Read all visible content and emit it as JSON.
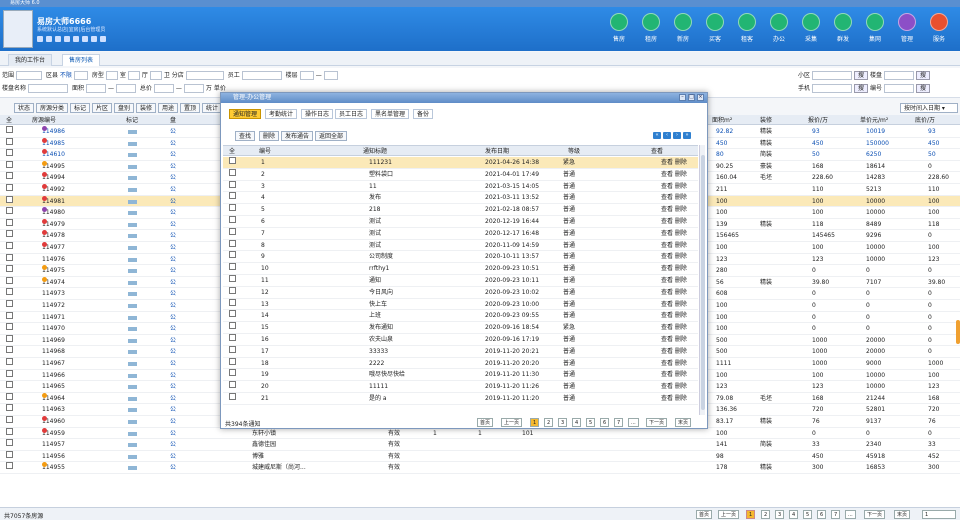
{
  "window_title": "易房大师 6.0",
  "header": {
    "user_name": "易房大师6666",
    "user_sub": "系统默认总店|宜房|后台管理员",
    "nav": [
      {
        "label": "售房",
        "icon": "home-icon",
        "color": "#22b573"
      },
      {
        "label": "租房",
        "icon": "home-key-icon",
        "color": "#22b573"
      },
      {
        "label": "新房",
        "icon": "building-icon",
        "color": "#22b573"
      },
      {
        "label": "买客",
        "icon": "buyer-icon",
        "color": "#22b573"
      },
      {
        "label": "租客",
        "icon": "tenant-icon",
        "color": "#22b573"
      },
      {
        "label": "办公",
        "icon": "office-icon",
        "color": "#22b573"
      },
      {
        "label": "采集",
        "icon": "cloud-icon",
        "color": "#22b573"
      },
      {
        "label": "群发",
        "icon": "send-icon",
        "color": "#22b573"
      },
      {
        "label": "集网",
        "icon": "network-icon",
        "color": "#22b573"
      },
      {
        "label": "管理",
        "icon": "gear-icon",
        "color": "#8c4fc7"
      },
      {
        "label": "服务",
        "icon": "service-icon",
        "color": "#e8502f"
      }
    ]
  },
  "tabs": [
    {
      "label": "我的工作台"
    },
    {
      "label": "售房列表"
    }
  ],
  "filter": {
    "row1": [
      "范围",
      "区县",
      "不限",
      "房型",
      "室",
      "厅",
      "卫",
      "分店",
      "员工",
      "楼层",
      "—"
    ],
    "row2": [
      "楼盘名称",
      "面积",
      "—",
      "总价",
      "—",
      "万",
      "单价"
    ],
    "right1": [
      "小区",
      "楼盘"
    ],
    "right2": [
      "手机",
      "编号"
    ],
    "search_btn": "搜"
  },
  "toolbar": [
    "状态",
    "房源分类",
    "标记",
    "片区",
    "盘别",
    "装修",
    "用途",
    "置顶",
    "统计"
  ],
  "sort_select": "按时间入日期",
  "grid": {
    "headers": [
      "全",
      "房源编号",
      "标记",
      "盘",
      "面积m²",
      "装修",
      "报价/万",
      "单价元/m²",
      "底价/万"
    ],
    "rows": [
      {
        "id": "114986",
        "flag": "#8e44ad",
        "bei": "公",
        "area": "92.82",
        "deco": "精装",
        "price": "93",
        "unit": "10019",
        "base": "93",
        "blue": true
      },
      {
        "id": "114985",
        "flag": "#e03b3b",
        "bei": "公",
        "area": "450",
        "deco": "精装",
        "price": "450",
        "unit": "150000",
        "base": "450",
        "blue": true
      },
      {
        "id": "114610",
        "flag": "#e03b3b",
        "bei": "公",
        "area": "80",
        "deco": "简装",
        "price": "50",
        "unit": "6250",
        "base": "50",
        "blue": true
      },
      {
        "id": "114995",
        "flag": "#f39c12",
        "bei": "公",
        "area": "90.25",
        "deco": "豪装",
        "price": "168",
        "unit": "18614",
        "base": "0"
      },
      {
        "id": "114994",
        "flag": "#e03b3b",
        "bei": "公",
        "area": "160.04",
        "deco": "毛坯",
        "price": "228.60",
        "unit": "14283",
        "base": "228.60"
      },
      {
        "id": "114992",
        "flag": "#e03b3b",
        "bei": "公",
        "area": "211",
        "deco": "",
        "price": "110",
        "unit": "5213",
        "base": "110"
      },
      {
        "id": "114981",
        "flag": "#e03b3b",
        "bei": "公",
        "area": "100",
        "deco": "",
        "price": "100",
        "unit": "10000",
        "base": "100",
        "sel": true
      },
      {
        "id": "114980",
        "flag": "#8e44ad",
        "bei": "公",
        "area": "100",
        "deco": "",
        "price": "100",
        "unit": "10000",
        "base": "100"
      },
      {
        "id": "114979",
        "flag": "#e03b3b",
        "bei": "公",
        "area": "139",
        "deco": "精装",
        "price": "118",
        "unit": "8489",
        "base": "118"
      },
      {
        "id": "114978",
        "flag": "#e03b3b",
        "bei": "公",
        "area": "156465",
        "deco": "",
        "price": "145465",
        "unit": "9296",
        "base": "0"
      },
      {
        "id": "114977",
        "flag": "#e03b3b",
        "bei": "公",
        "area": "100",
        "deco": "",
        "price": "100",
        "unit": "10000",
        "base": "100"
      },
      {
        "id": "114976",
        "flag": "",
        "bei": "公",
        "area": "123",
        "deco": "",
        "price": "123",
        "unit": "10000",
        "base": "123"
      },
      {
        "id": "114975",
        "flag": "#f39c12",
        "bei": "公",
        "area": "280",
        "deco": "",
        "price": "0",
        "unit": "0",
        "base": "0"
      },
      {
        "id": "114974",
        "flag": "#f39c12",
        "bei": "公",
        "area": "56",
        "deco": "精装",
        "price": "39.80",
        "unit": "7107",
        "base": "39.80"
      },
      {
        "id": "114973",
        "flag": "",
        "bei": "公",
        "area": "608",
        "deco": "",
        "price": "0",
        "unit": "0",
        "base": "0"
      },
      {
        "id": "114972",
        "flag": "",
        "bei": "公",
        "area": "100",
        "deco": "",
        "price": "0",
        "unit": "0",
        "base": "0"
      },
      {
        "id": "114971",
        "flag": "",
        "bei": "公",
        "area": "100",
        "deco": "",
        "price": "0",
        "unit": "0",
        "base": "0"
      },
      {
        "id": "114970",
        "flag": "",
        "bei": "公",
        "area": "100",
        "deco": "",
        "price": "0",
        "unit": "0",
        "base": "0"
      },
      {
        "id": "114969",
        "flag": "",
        "bei": "公",
        "area": "500",
        "deco": "",
        "price": "1000",
        "unit": "20000",
        "base": "0"
      },
      {
        "id": "114968",
        "flag": "",
        "bei": "公",
        "area": "500",
        "deco": "",
        "price": "1000",
        "unit": "20000",
        "base": "0"
      },
      {
        "id": "114967",
        "flag": "",
        "bei": "公",
        "area": "1111",
        "deco": "",
        "price": "1000",
        "unit": "9000",
        "base": "1000"
      },
      {
        "id": "114966",
        "flag": "",
        "bei": "公",
        "area": "100",
        "deco": "",
        "price": "100",
        "unit": "10000",
        "base": "100"
      },
      {
        "id": "114965",
        "flag": "",
        "bei": "公",
        "area": "123",
        "deco": "",
        "price": "123",
        "unit": "10000",
        "base": "123"
      },
      {
        "id": "114964",
        "flag": "#f39c12",
        "bei": "公",
        "area": "79.08",
        "deco": "毛坯",
        "price": "168",
        "unit": "21244",
        "base": "168"
      },
      {
        "id": "114963",
        "flag": "",
        "bei": "公",
        "area": "136.36",
        "deco": "",
        "price": "720",
        "unit": "52801",
        "base": "720"
      },
      {
        "id": "114960",
        "flag": "#e03b3b",
        "bei": "公",
        "area": "83.17",
        "deco": "精装",
        "price": "76",
        "unit": "9137",
        "base": "76"
      },
      {
        "id": "114959",
        "flag": "#e03b3b",
        "bei": "公",
        "area": "100",
        "deco": "",
        "price": "0",
        "unit": "0",
        "base": "0"
      },
      {
        "id": "114957",
        "flag": "",
        "bei": "公",
        "area": "141",
        "deco": "简装",
        "price": "33",
        "unit": "2340",
        "base": "33"
      },
      {
        "id": "114956",
        "flag": "",
        "bei": "公",
        "area": "98",
        "deco": "",
        "price": "450",
        "unit": "45918",
        "base": "452"
      },
      {
        "id": "114955",
        "flag": "#f39c12",
        "bei": "公",
        "area": "178",
        "deco": "精装",
        "price": "300",
        "unit": "16853",
        "base": "300"
      }
    ],
    "behind_modal": [
      {
        "name": "东轩小镇",
        "status": "有效",
        "a": "1",
        "b": "1",
        "c": "101"
      },
      {
        "name": "鑫德佳园",
        "status": "有效",
        "a": "",
        "b": "",
        "c": ""
      },
      {
        "name": "博雅",
        "status": "有效",
        "a": "",
        "b": "",
        "c": ""
      },
      {
        "name": "城建威尼斯（尚河...",
        "status": "有效",
        "a": "",
        "b": "",
        "c": ""
      }
    ]
  },
  "status": {
    "total": "共7057条房源",
    "pager": [
      "首页",
      "上一页",
      "1",
      "2",
      "3",
      "4",
      "5",
      "6",
      "7",
      "...",
      "下一页",
      "末页",
      "1"
    ]
  },
  "modal": {
    "title": "管理-办公管理",
    "tabs": [
      {
        "label": "通知管理"
      },
      {
        "label": "考勤统计"
      },
      {
        "label": "操作日志"
      },
      {
        "label": "员工日志"
      },
      {
        "label": "黑名单管理"
      },
      {
        "label": "备份"
      }
    ],
    "tools": [
      "查找",
      "删除",
      "发布通告",
      "返回全部"
    ],
    "headers": [
      "全",
      "编号",
      "通知标题",
      "发布日期",
      "等级",
      "查看"
    ],
    "rows": [
      {
        "no": "1",
        "title": "111231",
        "date": "2021-04-26 14:38",
        "level": "紧急",
        "sel": true
      },
      {
        "no": "2",
        "title": "塑料袋口",
        "date": "2021-04-01 17:49",
        "level": "普通"
      },
      {
        "no": "3",
        "title": "11",
        "date": "2021-03-15 14:05",
        "level": "普通"
      },
      {
        "no": "4",
        "title": "发布",
        "date": "2021-03-11 13:52",
        "level": "普通"
      },
      {
        "no": "5",
        "title": "218",
        "date": "2021-02-18 08:57",
        "level": "普通"
      },
      {
        "no": "6",
        "title": "测试",
        "date": "2020-12-19 16:44",
        "level": "普通"
      },
      {
        "no": "7",
        "title": "测试",
        "date": "2020-12-17 16:48",
        "level": "普通"
      },
      {
        "no": "8",
        "title": "测试",
        "date": "2020-11-09 14:59",
        "level": "普通"
      },
      {
        "no": "9",
        "title": "公司制度",
        "date": "2020-10-11 13:57",
        "level": "普通"
      },
      {
        "no": "10",
        "title": "rrfthy1",
        "date": "2020-09-23 10:51",
        "level": "普通"
      },
      {
        "no": "11",
        "title": "通知",
        "date": "2020-09-23 10:11",
        "level": "普通"
      },
      {
        "no": "12",
        "title": "今日风向",
        "date": "2020-09-23 10:02",
        "level": "普通"
      },
      {
        "no": "13",
        "title": "快上车",
        "date": "2020-09-23 10:00",
        "level": "普通"
      },
      {
        "no": "14",
        "title": "上班",
        "date": "2020-09-23 09:55",
        "level": "普通"
      },
      {
        "no": "15",
        "title": "发布通知",
        "date": "2020-09-16 18:54",
        "level": "紧急"
      },
      {
        "no": "16",
        "title": "农夫山泉",
        "date": "2020-09-16 17:19",
        "level": "普通"
      },
      {
        "no": "17",
        "title": "33333",
        "date": "2019-11-20 20:21",
        "level": "普通"
      },
      {
        "no": "18",
        "title": "2222",
        "date": "2019-11-20 20:20",
        "level": "普通"
      },
      {
        "no": "19",
        "title": "哦尽快尽快给",
        "date": "2019-11-20 11:30",
        "level": "普通"
      },
      {
        "no": "20",
        "title": "11111",
        "date": "2019-11-20 11:26",
        "level": "普通"
      },
      {
        "no": "21",
        "title": "是的 a",
        "date": "2019-11-20 11:20",
        "level": "普通"
      }
    ],
    "view_label": "查看 删除",
    "total": "共394条通知",
    "pager": [
      "首页",
      "上一页",
      "1",
      "2",
      "3",
      "4",
      "5",
      "6",
      "7",
      "...",
      "下一页",
      "末页"
    ]
  }
}
